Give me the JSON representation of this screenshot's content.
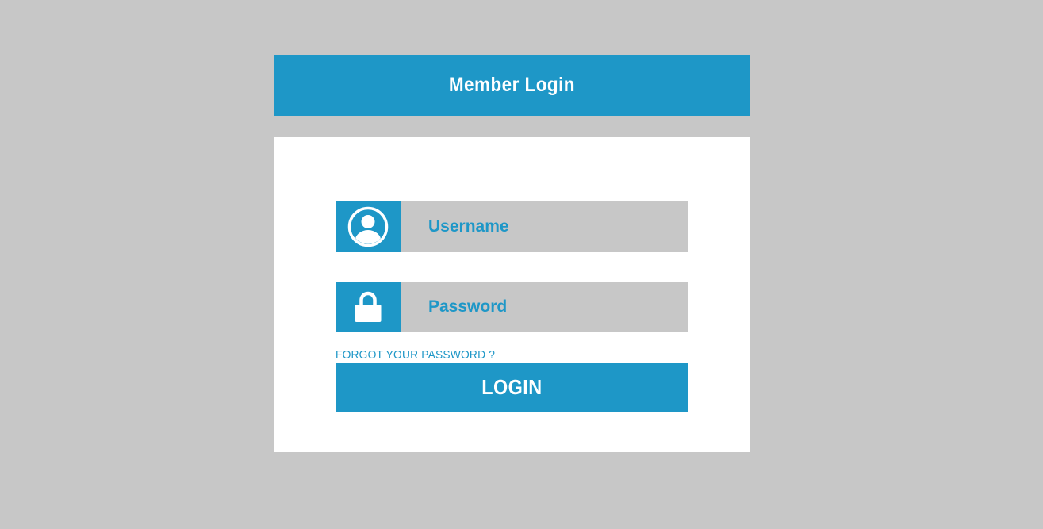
{
  "header": {
    "title": "Member Login"
  },
  "form": {
    "username": {
      "icon": "user-circle-icon",
      "placeholder": "Username",
      "value": ""
    },
    "password": {
      "icon": "lock-icon",
      "placeholder": "Password",
      "value": ""
    },
    "forgot_label": "FORGOT YOUR PASSWORD ?",
    "login_label": "LOGIN"
  },
  "colors": {
    "background": "#c7c7c7",
    "accent": "#1e97c7",
    "panel": "#ffffff",
    "text_on_accent": "#ffffff"
  }
}
